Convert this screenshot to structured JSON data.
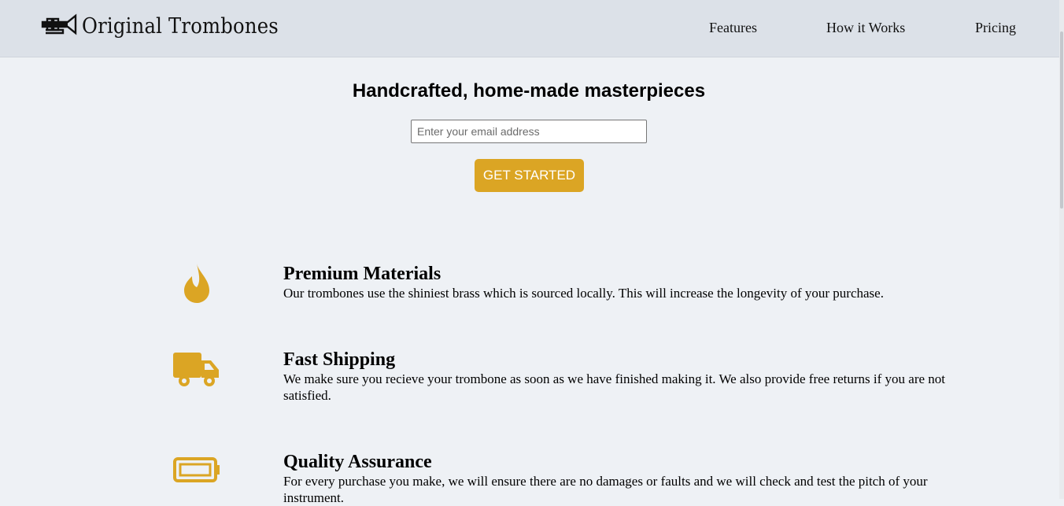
{
  "brand": {
    "name": "Original Trombones",
    "logo_icon": "trombone-icon",
    "accent_color": "#dba524"
  },
  "nav": [
    {
      "label": "Features"
    },
    {
      "label": "How it Works"
    },
    {
      "label": "Pricing"
    }
  ],
  "hero": {
    "title": "Handcrafted, home-made masterpieces",
    "email_placeholder": "Enter your email address",
    "cta_label": "GET STARTED"
  },
  "features": [
    {
      "icon": "fire-icon",
      "title": "Premium Materials",
      "text": "Our trombones use the shiniest brass which is sourced locally. This will increase the longevity of your purchase."
    },
    {
      "icon": "truck-icon",
      "title": "Fast Shipping",
      "text": "We make sure you recieve your trombone as soon as we have finished making it. We also provide free returns if you are not satisfied."
    },
    {
      "icon": "battery-icon",
      "title": "Quality Assurance",
      "text": "For every purchase you make, we will ensure there are no damages or faults and we will check and test the pitch of your instrument."
    }
  ]
}
